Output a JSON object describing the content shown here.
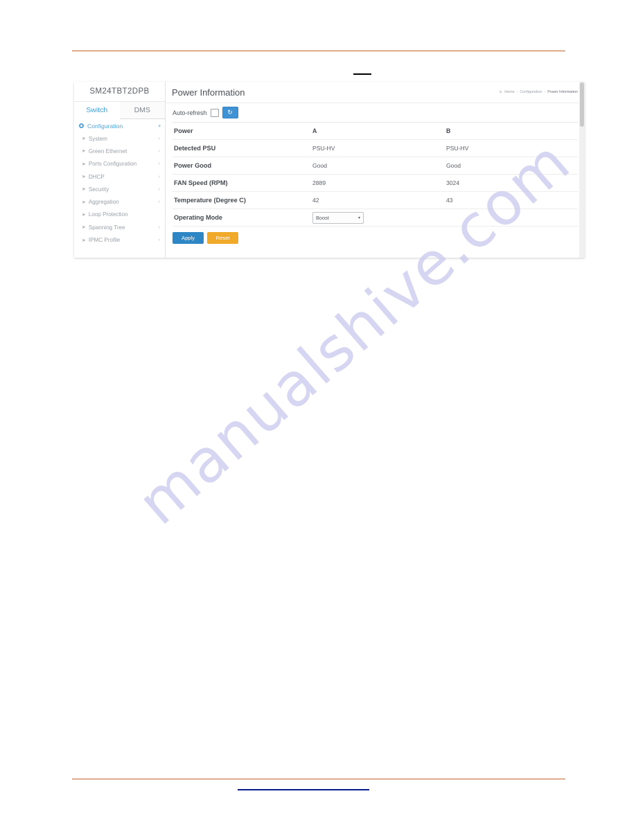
{
  "document": {
    "watermark": "manualshive.com"
  },
  "screenshot": {
    "sidebar": {
      "brand": "SM24TBT2DPB",
      "tabs": [
        {
          "label": "Switch",
          "active": true
        },
        {
          "label": "DMS",
          "active": false
        }
      ],
      "section": {
        "label": "Configuration",
        "expand_icon": "chevron-down-icon"
      },
      "items": [
        {
          "label": "System",
          "has_chevron": true
        },
        {
          "label": "Green Ethernet",
          "has_chevron": true
        },
        {
          "label": "Ports Configuration",
          "has_chevron": true
        },
        {
          "label": "DHCP",
          "has_chevron": true
        },
        {
          "label": "Security",
          "has_chevron": true
        },
        {
          "label": "Aggregation",
          "has_chevron": true
        },
        {
          "label": "Loop Protection",
          "has_chevron": false
        },
        {
          "label": "Spanning Tree",
          "has_chevron": true
        },
        {
          "label": "IPMC Profile",
          "has_chevron": true
        }
      ]
    },
    "header": {
      "title": "Power Information",
      "breadcrumb": {
        "home_icon": "home-icon",
        "items": [
          "Home",
          "Configuration",
          "Power Information"
        ],
        "separator": "›"
      }
    },
    "toolbar": {
      "auto_refresh_label": "Auto-refresh",
      "auto_refresh_checked": false,
      "refresh_icon": "refresh-icon"
    },
    "table": {
      "columns": [
        "Power",
        "A",
        "B"
      ],
      "rows": [
        {
          "label": "Detected PSU",
          "a": "PSU-HV",
          "b": "PSU-HV"
        },
        {
          "label": "Power Good",
          "a": "Good",
          "b": "Good"
        },
        {
          "label": "FAN Speed (RPM)",
          "a": "2889",
          "b": "3024"
        },
        {
          "label": "Temperature (Degree C)",
          "a": "42",
          "b": "43"
        }
      ],
      "operating_mode": {
        "label": "Operating Mode",
        "selected": "Boost",
        "caret_icon": "chevron-down-icon"
      }
    },
    "actions": {
      "apply_label": "Apply",
      "reset_label": "Reset"
    },
    "colors": {
      "accent_blue": "#3f93d4",
      "apply_blue": "#2e87c4",
      "reset_orange": "#f0a929",
      "rule_orange": "#c0622a",
      "link_blue": "#071a8c",
      "watermark": "#c9c9ee"
    }
  }
}
